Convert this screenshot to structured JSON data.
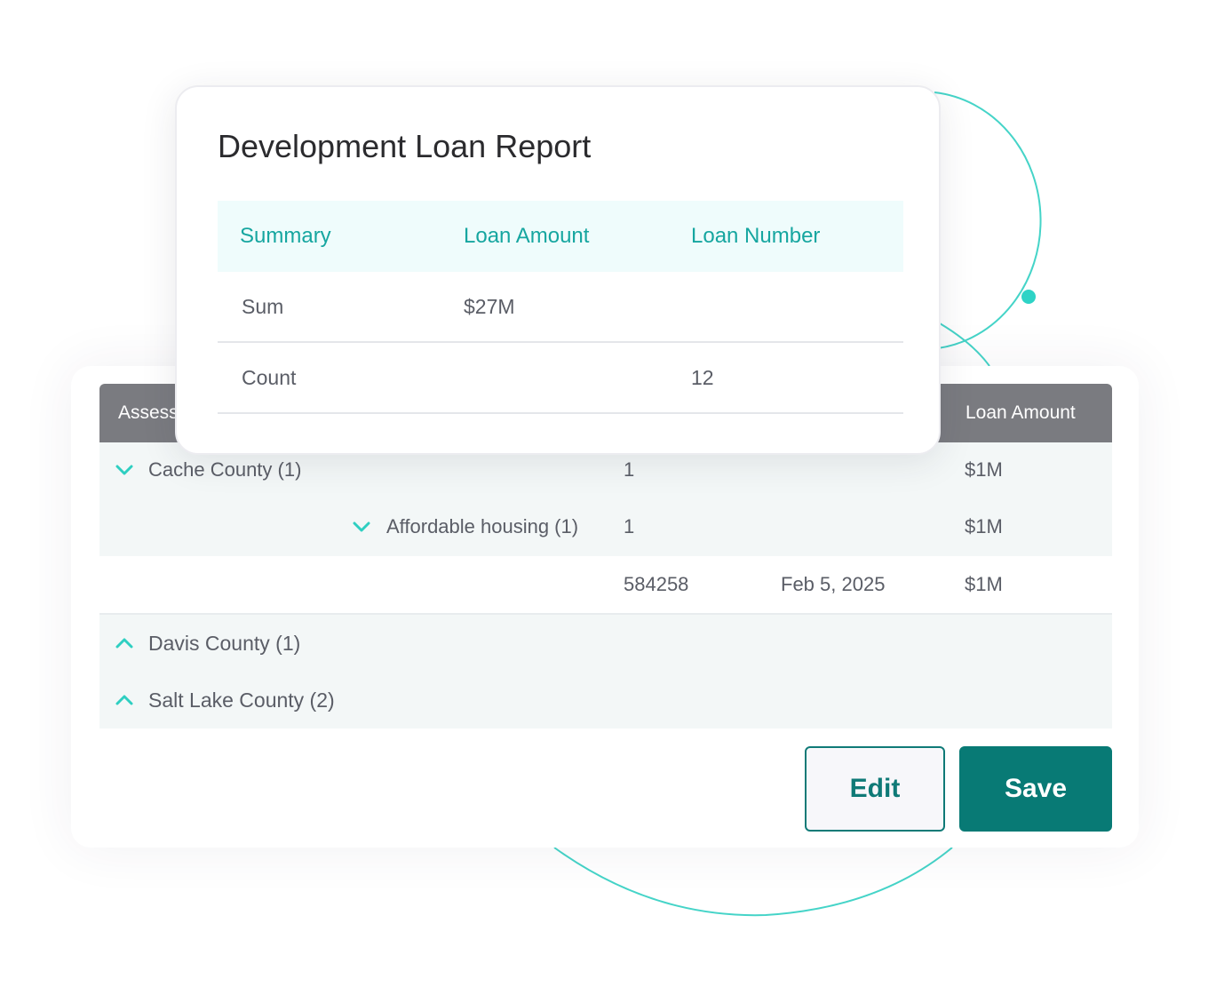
{
  "report": {
    "title": "Development Loan Report",
    "columns": [
      "Summary",
      "Loan Amount",
      "Loan Number"
    ],
    "rows": [
      {
        "label": "Sum",
        "loan_amount": "$27M",
        "loan_number": ""
      },
      {
        "label": "Count",
        "loan_amount": "",
        "loan_number": "12"
      }
    ]
  },
  "grid": {
    "header": {
      "first": "Assessment",
      "last": "Loan Amount"
    },
    "groups": [
      {
        "label": "Cache County (1)",
        "count": "1",
        "amount": "$1M",
        "expanded": true,
        "subgroups": [
          {
            "label": "Affordable housing (1)",
            "count": "1",
            "amount": "$1M",
            "expanded": true,
            "records": [
              {
                "loan_number": "584258",
                "date": "Feb 5, 2025",
                "amount": "$1M"
              }
            ]
          }
        ]
      },
      {
        "label": "Davis County (1)",
        "expanded": false
      },
      {
        "label": "Salt Lake County (2)",
        "expanded": false
      }
    ]
  },
  "actions": {
    "edit_label": "Edit",
    "save_label": "Save"
  },
  "colors": {
    "accent": "#2ed3c6",
    "primary": "#087a75",
    "header_bg": "#7a7b80",
    "summary_header_text": "#16a6a0"
  },
  "icons": {
    "expanded": "chevron-down-icon",
    "collapsed": "chevron-up-icon"
  }
}
